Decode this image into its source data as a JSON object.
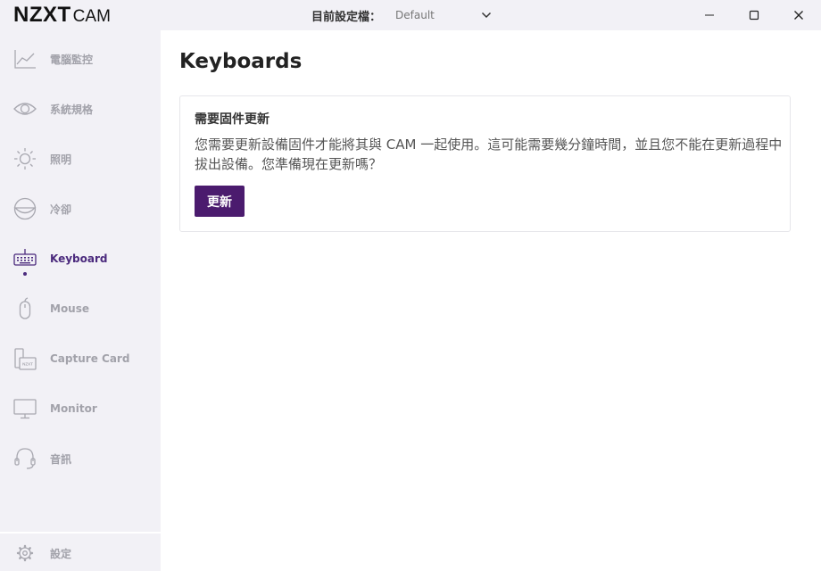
{
  "app": {
    "brand": "NZXT",
    "product": "CAM"
  },
  "profile": {
    "label": "目前設定檔：",
    "value": "Default"
  },
  "window_controls": {
    "icons": [
      "minimize-icon",
      "maximize-icon",
      "close-icon"
    ]
  },
  "sidebar": {
    "items": [
      {
        "label": "電腦監控",
        "icon": "line-chart-icon"
      },
      {
        "label": "系統規格",
        "icon": "eye-icon"
      },
      {
        "label": "照明",
        "icon": "sun-icon"
      },
      {
        "label": "冷卻",
        "icon": "fan-icon"
      },
      {
        "label": "Keyboard",
        "icon": "keyboard-icon",
        "active": true
      },
      {
        "label": "Mouse",
        "icon": "mouse-icon"
      },
      {
        "label": "Capture Card",
        "icon": "capture-card-icon",
        "icon_text": "NZXT"
      },
      {
        "label": "Monitor",
        "icon": "monitor-icon"
      },
      {
        "label": "音訊",
        "icon": "headset-icon"
      }
    ],
    "settings": {
      "label": "設定",
      "icon": "gear-icon"
    }
  },
  "main": {
    "title": "Keyboards",
    "card": {
      "title": "需要固件更新",
      "body": "您需要更新設備固件才能將其與 CAM 一起使用。這可能需要幾分鐘時間，並且您不能在更新過程中拔出設備。您準備現在更新嗎？",
      "button_label": "更新"
    }
  },
  "colors": {
    "accent": "#4b1b6e",
    "active_nav": "#4b2a7d",
    "sidebar_bg": "#f2f1f6"
  }
}
